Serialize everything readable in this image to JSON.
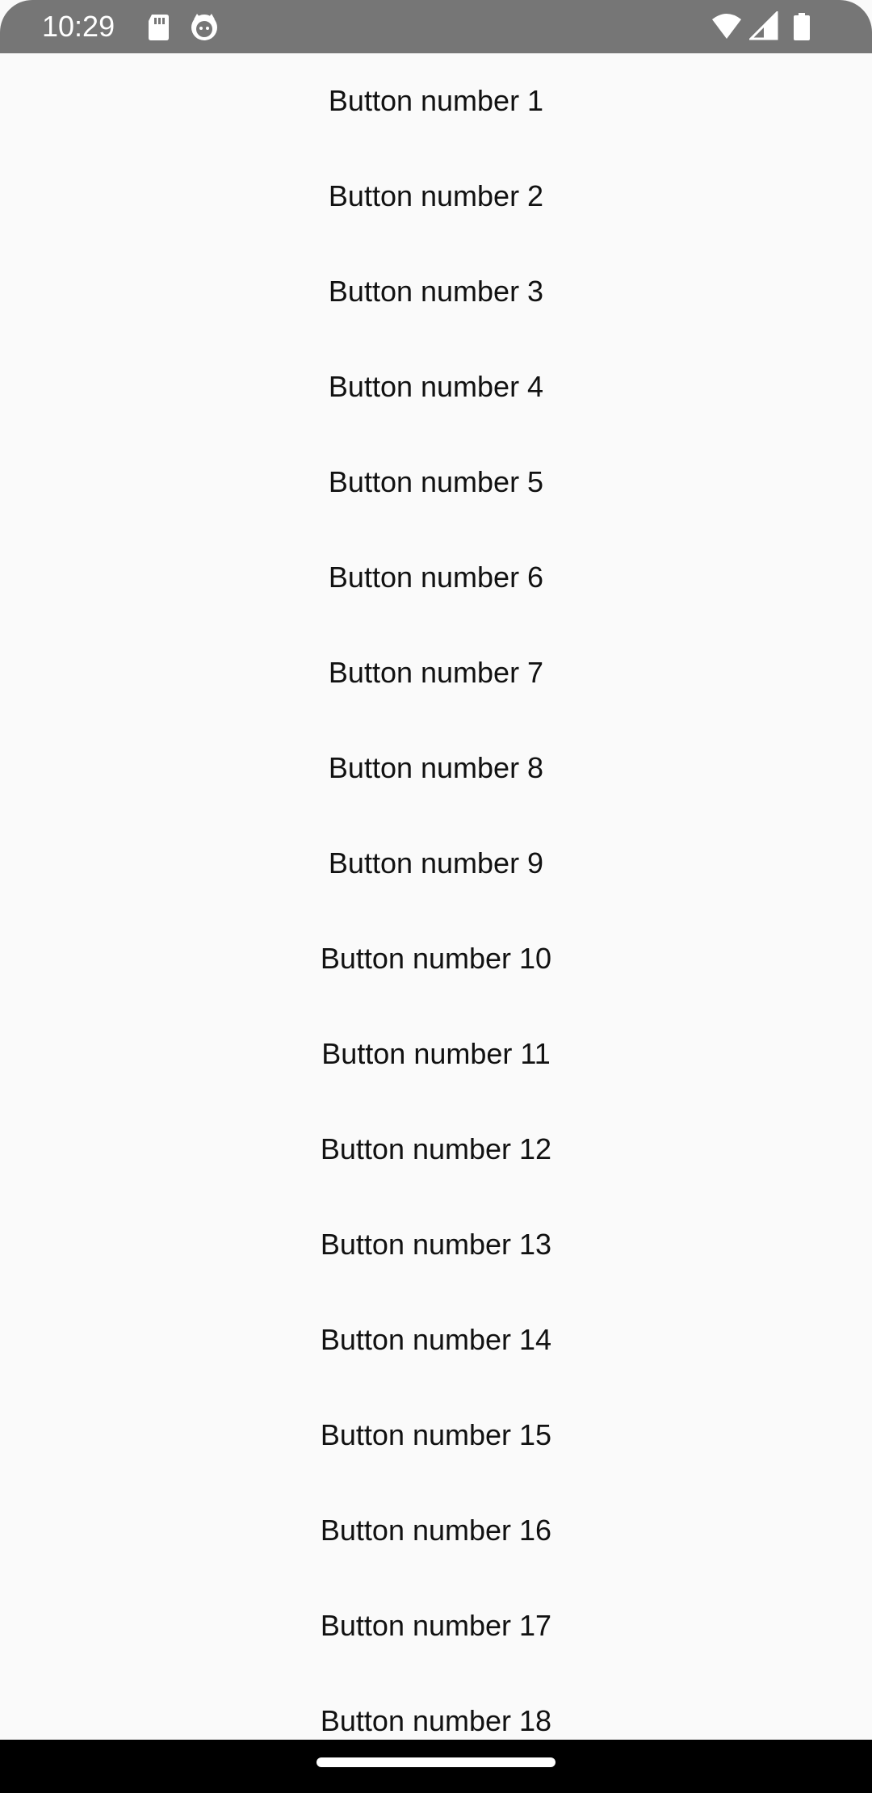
{
  "status_bar": {
    "time": "10:29",
    "icons_left": [
      "sd-card-icon",
      "cat-face-icon"
    ],
    "icons_right": [
      "wifi-icon",
      "cell-signal-icon",
      "battery-icon"
    ],
    "background": "#767676"
  },
  "buttons": [
    {
      "label": "Button number 1"
    },
    {
      "label": "Button number 2"
    },
    {
      "label": "Button number 3"
    },
    {
      "label": "Button number 4"
    },
    {
      "label": "Button number 5"
    },
    {
      "label": "Button number 6"
    },
    {
      "label": "Button number 7"
    },
    {
      "label": "Button number 8"
    },
    {
      "label": "Button number 9"
    },
    {
      "label": "Button number 10"
    },
    {
      "label": "Button number 11"
    },
    {
      "label": "Button number 12"
    },
    {
      "label": "Button number 13"
    },
    {
      "label": "Button number 14"
    },
    {
      "label": "Button number 15"
    },
    {
      "label": "Button number 16"
    },
    {
      "label": "Button number 17"
    },
    {
      "label": "Button number 18"
    }
  ],
  "nav_bar": {
    "background": "#000000"
  }
}
